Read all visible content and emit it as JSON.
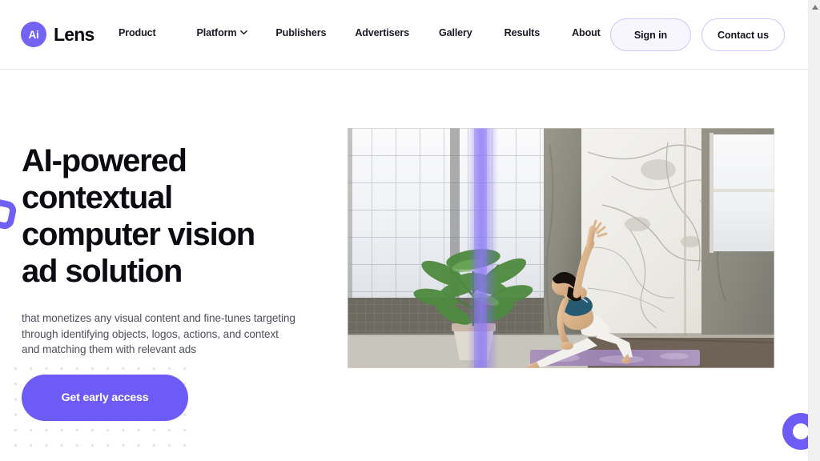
{
  "brand": {
    "mark_text": "Ai",
    "name": "Lens",
    "mark_color": "#7263f3"
  },
  "nav": {
    "items": [
      {
        "label": "Product",
        "has_dropdown": false
      },
      {
        "label": "Platform",
        "has_dropdown": true,
        "dropdown_icon": "chevron-down-icon"
      },
      {
        "label": "Publishers",
        "has_dropdown": false
      },
      {
        "label": "Advertisers",
        "has_dropdown": false
      },
      {
        "label": "Gallery",
        "has_dropdown": false
      },
      {
        "label": "Results",
        "has_dropdown": false
      },
      {
        "label": "About",
        "has_dropdown": false
      }
    ]
  },
  "header_actions": {
    "sign_in_label": "Sign in",
    "contact_label": "Contact us",
    "border_color": "#cfc8f7"
  },
  "hero": {
    "headline": "AI-powered contextual computer vision ad solution",
    "subhead": "that monetizes any visual content and fine-tunes targeting through identifying objects, logos, actions, and context and matching them with relevant ads",
    "cta_label": "Get early access",
    "cta_color": "#6c5cf5",
    "image_alt": "Woman in a low lunge yoga pose on a purple mat in a bright studio with a marble wall, concrete pillar, potted palm and large window",
    "accent_color": "#6f5ff5"
  },
  "decorations": {
    "left_square_name": "rounded-square-outline",
    "bottom_right_ring_name": "ring-outline",
    "dot_grid_name": "dot-grid-pattern"
  },
  "scrollbar": {
    "up_arrow": "scroll-up-arrow-icon"
  }
}
